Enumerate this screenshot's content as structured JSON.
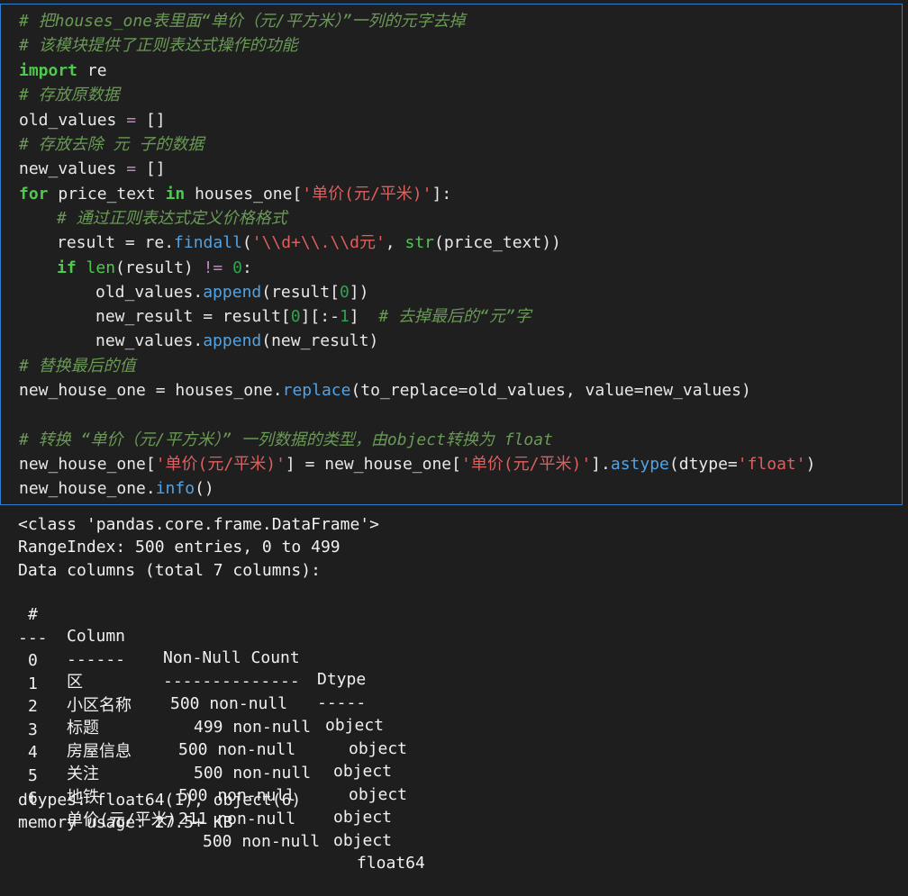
{
  "code": {
    "line1": "# 把houses_one表里面“单价（元/平方米）”一列的元字去掉",
    "line2": "# 该模块提供了正则表达式操作的功能",
    "line3_kw": "import",
    "line3_rest": " re",
    "line4": "# 存放原数据",
    "line5_var": "old_values",
    "line5_eq": " = ",
    "line5_val": "[]",
    "line6": "# 存放去除 元 子的数据",
    "line7_var": "new_values",
    "line7_eq": " = ",
    "line7_val": "[]",
    "line8_for": "for",
    "line8_a": " price_text ",
    "line8_in": "in",
    "line8_b": " houses_one[",
    "line8_str": "'单价(元/平米)'",
    "line8_c": "]:",
    "line9": "# 通过正则表达式定义价格格式",
    "line10_a": "result = re.",
    "line10_fn": "findall",
    "line10_b": "(",
    "line10_str": "'\\\\d+\\\\.\\\\d元'",
    "line10_c": ", ",
    "line10_bi": "str",
    "line10_d": "(price_text))",
    "line11_if": "if",
    "line11_sp": " ",
    "line11_bi": "len",
    "line11_a": "(result) ",
    "line11_op": "!=",
    "line11_sp2": " ",
    "line11_num": "0",
    "line11_b": ":",
    "line12_a": "old_values.",
    "line12_fn": "append",
    "line12_b": "(result[",
    "line12_num": "0",
    "line12_c": "])",
    "line13_a": "new_result = result[",
    "line13_num1": "0",
    "line13_b": "][:-",
    "line13_num2": "1",
    "line13_c": "]  ",
    "line13_cm": "# 去掉最后的“元”字",
    "line14_a": "new_values.",
    "line14_fn": "append",
    "line14_b": "(new_result)",
    "line15": "# 替换最后的值",
    "line16_a": "new_house_one = houses_one.",
    "line16_fn": "replace",
    "line16_b": "(to_replace=old_values, value=new_values)",
    "line18": "# 转换 “单价（元/平方米）” 一列数据的类型，由object转换为 float",
    "line19_a": "new_house_one[",
    "line19_str1": "'单价(元/平米)'",
    "line19_b": "] = new_house_one[",
    "line19_str2": "'单价(元/平米)'",
    "line19_c": "].",
    "line19_fn": "astype",
    "line19_d": "(dtype=",
    "line19_str3": "'float'",
    "line19_e": ")",
    "line20_a": "new_house_one.",
    "line20_fn": "info",
    "line20_b": "()"
  },
  "output": {
    "class_line": "<class 'pandas.core.frame.DataFrame'>",
    "range_index": "RangeIndex: 500 entries, 0 to 499",
    "data_columns": "Data columns (total 7 columns):",
    "header": {
      "hash": "#",
      "column": "Column",
      "count": "Non-Null Count",
      "dtype": "Dtype"
    },
    "separator": {
      "hash": "---",
      "column": "------",
      "count": "--------------",
      "dtype": "-----"
    },
    "rows": [
      {
        "idx": "0",
        "name": "区",
        "count": "500 non-null",
        "dtype": "object"
      },
      {
        "idx": "1",
        "name": "小区名称",
        "count": "499 non-null",
        "dtype": "object"
      },
      {
        "idx": "2",
        "name": "标题",
        "count": "500 non-null",
        "dtype": "object"
      },
      {
        "idx": "3",
        "name": "房屋信息",
        "count": "500 non-null",
        "dtype": "object"
      },
      {
        "idx": "4",
        "name": "关注",
        "count": "500 non-null",
        "dtype": "object"
      },
      {
        "idx": "5",
        "name": "地铁",
        "count": "211 non-null",
        "dtype": "object"
      },
      {
        "idx": "6",
        "name": "单价(元/平米)",
        "count": "500 non-null",
        "dtype": "float64"
      }
    ],
    "dtypes": "dtypes: float64(1), object(6)",
    "memory": "memory usage: 27.5+ KB"
  }
}
